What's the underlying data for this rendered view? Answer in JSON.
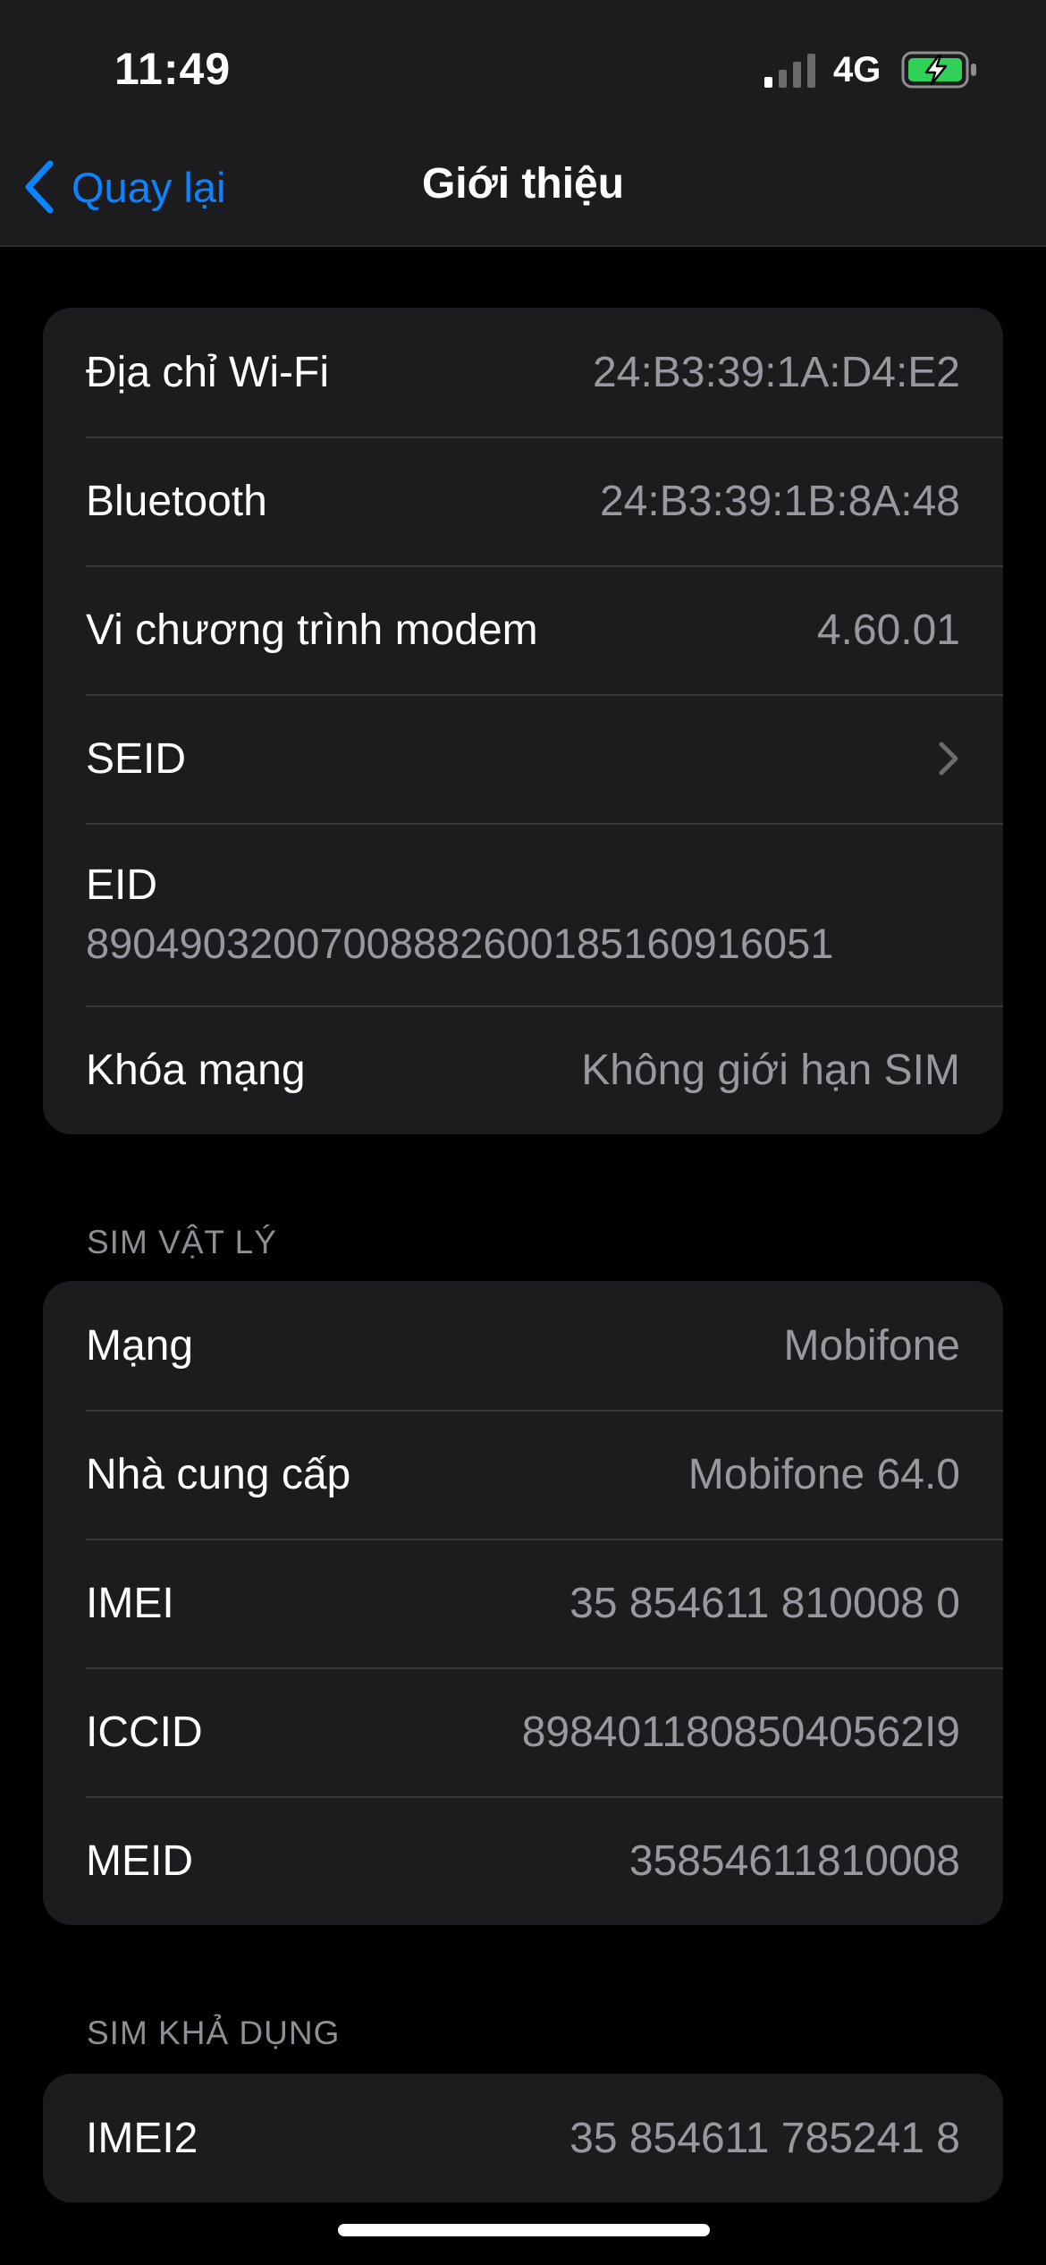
{
  "status_bar": {
    "time": "11:49",
    "network_type": "4G",
    "signal_icon": "cellular-signal-icon",
    "battery_icon": "battery-charging-icon",
    "battery_color": "#30d158"
  },
  "nav": {
    "back_label": "Quay lại",
    "title": "Giới thiệu",
    "accent_color": "#0a84ff"
  },
  "device_info": {
    "rows": [
      {
        "label": "Địa chỉ Wi-Fi",
        "value": "24:B3:39:1A:D4:E2"
      },
      {
        "label": "Bluetooth",
        "value": "24:B3:39:1B:8A:48"
      },
      {
        "label": "Vi chương trình modem",
        "value": "4.60.01"
      },
      {
        "label": "SEID",
        "icon": "chevron-right-icon"
      },
      {
        "label": "EID",
        "value": "89049032007008882600185160916051"
      },
      {
        "label": "Khóa mạng",
        "value": "Không giới hạn SIM"
      }
    ]
  },
  "physical_sim": {
    "header": "SIM VẬT LÝ",
    "rows": [
      {
        "label": "Mạng",
        "value": "Mobifone"
      },
      {
        "label": "Nhà cung cấp",
        "value": "Mobifone 64.0"
      },
      {
        "label": "IMEI",
        "value": "35 854611 810008 0"
      },
      {
        "label": "ICCID",
        "value": "89840118085040562I9"
      },
      {
        "label": "MEID",
        "value": "35854611810008"
      }
    ]
  },
  "available_sim": {
    "header": "SIM KHẢ DỤNG",
    "rows": [
      {
        "label": "IMEI2",
        "value": "35 854611 785241 8"
      }
    ]
  }
}
